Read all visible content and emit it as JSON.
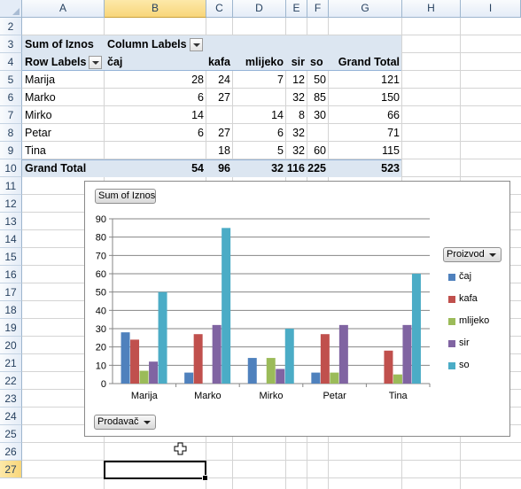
{
  "columns": [
    "A",
    "B",
    "C",
    "D",
    "E",
    "F",
    "G",
    "H",
    "I"
  ],
  "rows": [
    "2",
    "3",
    "4",
    "5",
    "6",
    "7",
    "8",
    "9",
    "10",
    "11",
    "12",
    "13",
    "14",
    "15",
    "16",
    "17",
    "18",
    "19",
    "20",
    "21",
    "22",
    "23",
    "24",
    "25",
    "26",
    "27"
  ],
  "selected_column": "B",
  "selected_row": "27",
  "pivot": {
    "sum_label": "Sum of Iznos",
    "column_labels": "Column Labels",
    "row_labels": "Row Labels",
    "col_fields": [
      "čaj",
      "kafa",
      "mlijeko",
      "sir",
      "so"
    ],
    "grand_total_label": "Grand Total",
    "rows": [
      {
        "name": "Marija",
        "values": [
          "28",
          "24",
          "7",
          "12",
          "50"
        ],
        "total": "121"
      },
      {
        "name": "Marko",
        "values": [
          "6",
          "27",
          "",
          "32",
          "85"
        ],
        "total": "150"
      },
      {
        "name": "Mirko",
        "values": [
          "14",
          "",
          "14",
          "8",
          "30"
        ],
        "total": "66"
      },
      {
        "name": "Petar",
        "values": [
          "6",
          "27",
          "6",
          "32",
          ""
        ],
        "total": "71"
      },
      {
        "name": "Tina",
        "values": [
          "",
          "18",
          "5",
          "32",
          "60"
        ],
        "total": "115"
      }
    ],
    "grand_totals": [
      "54",
      "96",
      "32",
      "116",
      "225"
    ],
    "grand_total": "523"
  },
  "chart": {
    "value_button": "Sum of Iznos",
    "legend_button": "Proizvod",
    "axis_button": "Prodavač"
  },
  "chart_data": {
    "type": "bar",
    "title": "",
    "categories": [
      "Marija",
      "Marko",
      "Mirko",
      "Petar",
      "Tina"
    ],
    "series": [
      {
        "name": "čaj",
        "values": [
          28,
          6,
          14,
          6,
          0
        ],
        "color": "#4f81bd"
      },
      {
        "name": "kafa",
        "values": [
          24,
          27,
          0,
          27,
          18
        ],
        "color": "#c0504d"
      },
      {
        "name": "mlijeko",
        "values": [
          7,
          0,
          14,
          6,
          5
        ],
        "color": "#9bbb59"
      },
      {
        "name": "sir",
        "values": [
          12,
          32,
          8,
          32,
          32
        ],
        "color": "#8064a2"
      },
      {
        "name": "so",
        "values": [
          50,
          85,
          30,
          0,
          60
        ],
        "color": "#4bacc6"
      }
    ],
    "ylim": [
      0,
      90
    ],
    "yticks": [
      0,
      10,
      20,
      30,
      40,
      50,
      60,
      70,
      80,
      90
    ],
    "grid": true,
    "legend": "right"
  }
}
